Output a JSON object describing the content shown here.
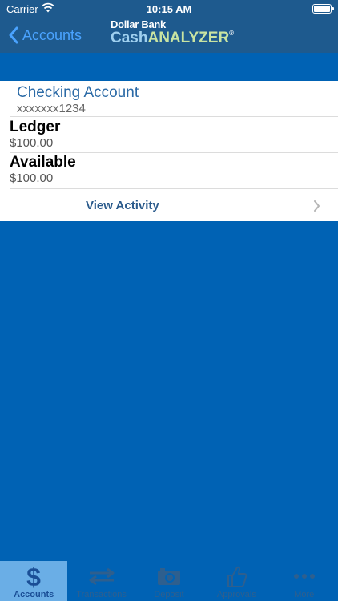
{
  "status": {
    "carrier": "Carrier",
    "time": "10:15 AM"
  },
  "nav": {
    "back_label": "Accounts",
    "logo_line1": "Dollar Bank",
    "logo_cash": "Cash",
    "logo_analyzer": "ANALYZER",
    "logo_mark": "®"
  },
  "account": {
    "name": "Checking Account",
    "number": "xxxxxxx1234",
    "ledger_label": "Ledger",
    "ledger_value": "$100.00",
    "available_label": "Available",
    "available_value": "$100.00",
    "view_activity_label": "View Activity"
  },
  "tabs": [
    {
      "label": "Accounts",
      "icon": "dollar-icon",
      "active": true
    },
    {
      "label": "Transactions",
      "icon": "transfer-arrows-icon",
      "active": false
    },
    {
      "label": "Deposit",
      "icon": "camera-icon",
      "active": false
    },
    {
      "label": "Approvals",
      "icon": "thumbs-up-icon",
      "active": false
    },
    {
      "label": "More",
      "icon": "more-dots-icon",
      "active": false
    }
  ],
  "colors": {
    "background": "#0062b4",
    "header": "#1e5a8e",
    "accent": "#4aa3ff",
    "active_tab": "#6aaee6"
  }
}
